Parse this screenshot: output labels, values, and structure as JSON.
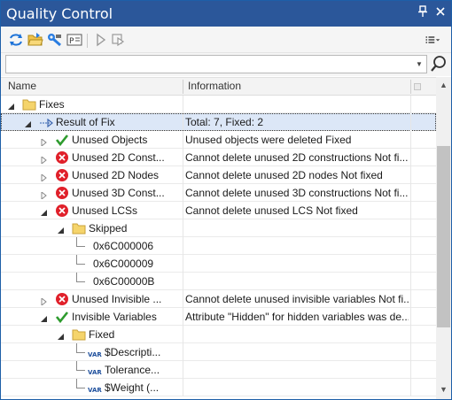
{
  "window": {
    "title": "Quality Control"
  },
  "title_buttons": {
    "pin_icon": "pin-icon",
    "close_icon": "close-icon"
  },
  "toolbar": {
    "items": [
      "refresh-icon",
      "open-folder-icon",
      "wrench-icon",
      "properties-icon",
      "play-icon",
      "step-icon",
      "list-view-icon"
    ]
  },
  "filter": {
    "value": "",
    "placeholder": ""
  },
  "columns": {
    "name": "Name",
    "information": "Information"
  },
  "rows": [
    {
      "name": "Fixes",
      "info": "",
      "icon": "folder-icon",
      "status": ""
    },
    {
      "name": "Result of Fix",
      "info": "Total: 7, Fixed: 2",
      "icon": "result-arrow-icon",
      "status": "selected"
    },
    {
      "name": "Unused Objects",
      "info": "Unused objects were deleted Fixed",
      "icon": "check-icon",
      "status": "fixed"
    },
    {
      "name": "Unused 2D Const...",
      "info": "Cannot delete unused 2D constructions Not fi...",
      "icon": "error-icon",
      "status": "error"
    },
    {
      "name": "Unused 2D Nodes",
      "info": "Cannot delete unused 2D nodes Not fixed",
      "icon": "error-icon",
      "status": "error"
    },
    {
      "name": "Unused 3D Const...",
      "info": "Cannot delete unused 3D constructions Not fi...",
      "icon": "error-icon",
      "status": "error"
    },
    {
      "name": "Unused LCSs",
      "info": "Cannot delete unused LCS  Not fixed",
      "icon": "error-icon",
      "status": "error"
    },
    {
      "name": "Skipped",
      "info": "",
      "icon": "folder-icon",
      "status": ""
    },
    {
      "name": "0x6C000006",
      "info": "",
      "icon": "",
      "status": ""
    },
    {
      "name": "0x6C000009",
      "info": "",
      "icon": "",
      "status": ""
    },
    {
      "name": "0x6C00000B",
      "info": "",
      "icon": "",
      "status": ""
    },
    {
      "name": "Unused Invisible ...",
      "info": "Cannot delete unused invisible variables Not fi...",
      "icon": "error-icon",
      "status": "error"
    },
    {
      "name": "Invisible Variables",
      "info": "Attribute \"Hidden\" for hidden variables was de...",
      "icon": "check-icon",
      "status": "fixed"
    },
    {
      "name": "Fixed",
      "info": "",
      "icon": "folder-icon",
      "status": ""
    },
    {
      "name": "$Descripti...",
      "info": "",
      "icon": "variable-icon",
      "status": ""
    },
    {
      "name": "Tolerance...",
      "info": "",
      "icon": "variable-icon",
      "status": ""
    },
    {
      "name": "$Weight (...",
      "info": "",
      "icon": "variable-icon",
      "status": ""
    }
  ],
  "icon_labels": {
    "variable": "VAR"
  },
  "colors": {
    "titlebar": "#2b579a",
    "selected_row": "#dce7f7",
    "error": "#e0202a",
    "fixed": "#2e9b2e",
    "folder": "#f5d46b"
  }
}
